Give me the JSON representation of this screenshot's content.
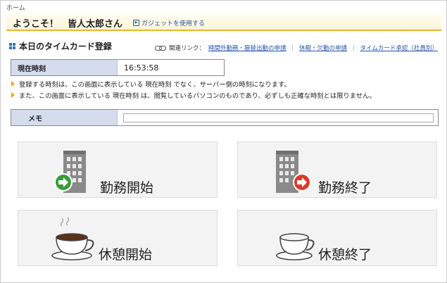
{
  "breadcrumb": "ホーム",
  "welcome": {
    "greeting": "ようこそ！　皆人太郎さん",
    "gadget_link": "ガジェットを使用する"
  },
  "section": {
    "title": "本日のタイムカード登録",
    "related_label": "関連リンク：",
    "links": [
      "時間外勤務・振替出勤の申請",
      "休暇・欠勤の申請",
      "タイムカード承認（社員別）"
    ],
    "separator": "｜"
  },
  "current_time": {
    "label": "現在時刻",
    "value": "16:53:58"
  },
  "notes": [
    "登録する時刻は、この画面に表示している 現在時刻 でなく、サーバー側の時刻になります。",
    "また、この画面に表示している 現在時刻 は、閲覧しているパソコンのものであり、必ずしも正確な時刻とは限りません。"
  ],
  "memo": {
    "label": "メモ",
    "value": ""
  },
  "buttons": {
    "work_start": {
      "label": "勤務開始",
      "icon": "building-arrow-green-icon"
    },
    "work_end": {
      "label": "勤務終了",
      "icon": "building-arrow-red-icon"
    },
    "break_start": {
      "label": "休憩開始",
      "icon": "coffee-cup-steam-icon"
    },
    "break_end": {
      "label": "休憩終了",
      "icon": "empty-cup-icon"
    }
  },
  "colors": {
    "accent": "#f0b428",
    "link": "#2255aa",
    "label_bg": "#d4dcee",
    "start_green": "#3a9a3a",
    "end_red": "#d93a30"
  }
}
